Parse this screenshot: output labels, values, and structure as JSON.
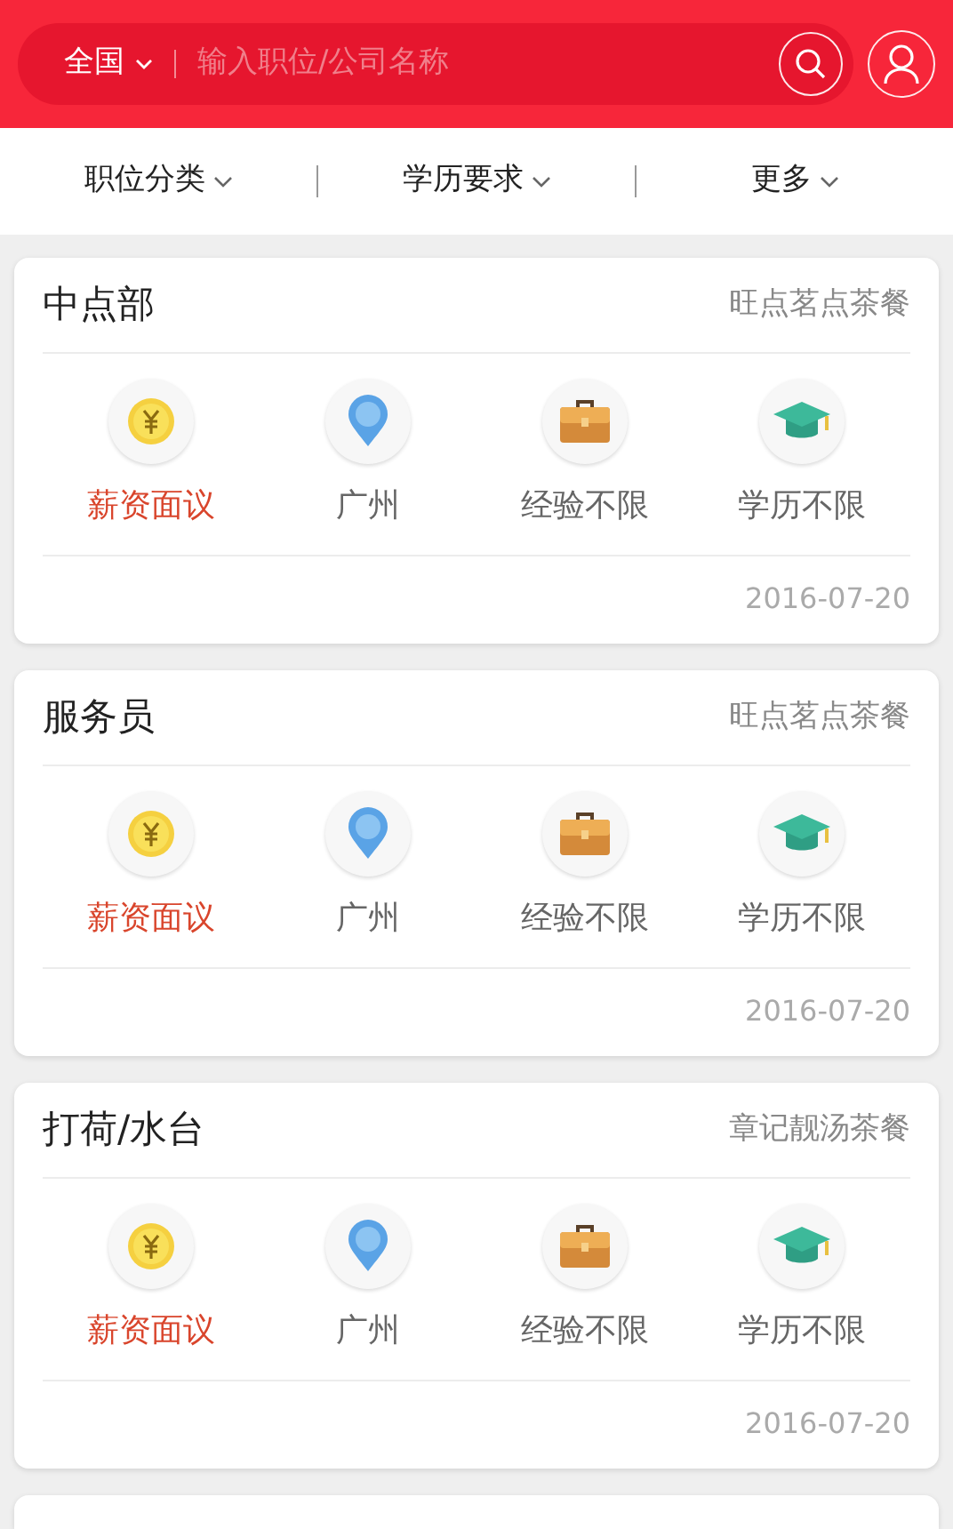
{
  "search": {
    "region": "全国",
    "placeholder": "输入职位/公司名称"
  },
  "filters": [
    {
      "label": "职位分类"
    },
    {
      "label": "学历要求"
    },
    {
      "label": "更多"
    }
  ],
  "jobs": [
    {
      "title": "中点部",
      "company": "旺点茗点茶餐",
      "tags": [
        {
          "kind": "salary",
          "text": "薪资面议"
        },
        {
          "kind": "location",
          "text": "广州"
        },
        {
          "kind": "experience",
          "text": "经验不限"
        },
        {
          "kind": "education",
          "text": "学历不限"
        }
      ],
      "date": "2016-07-20"
    },
    {
      "title": "服务员",
      "company": "旺点茗点茶餐",
      "tags": [
        {
          "kind": "salary",
          "text": "薪资面议"
        },
        {
          "kind": "location",
          "text": "广州"
        },
        {
          "kind": "experience",
          "text": "经验不限"
        },
        {
          "kind": "education",
          "text": "学历不限"
        }
      ],
      "date": "2016-07-20"
    },
    {
      "title": "打荷/水台",
      "company": "章记靓汤茶餐",
      "tags": [
        {
          "kind": "salary",
          "text": "薪资面议"
        },
        {
          "kind": "location",
          "text": "广州"
        },
        {
          "kind": "experience",
          "text": "经验不限"
        },
        {
          "kind": "education",
          "text": "学历不限"
        }
      ],
      "date": "2016-07-20"
    },
    {
      "cut": true
    }
  ]
}
